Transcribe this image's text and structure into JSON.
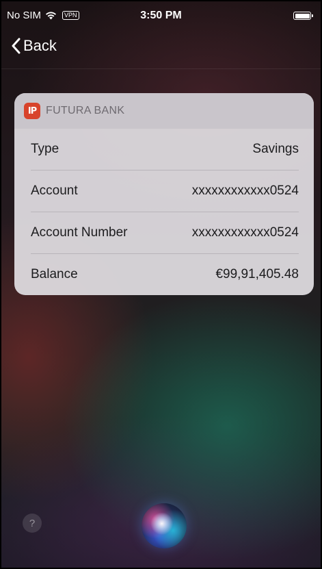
{
  "status_bar": {
    "carrier": "No SIM",
    "vpn": "VPN",
    "time": "3:50 PM"
  },
  "nav": {
    "back_label": "Back"
  },
  "card": {
    "bank_logo": "IP",
    "bank_name": "FUTURA BANK",
    "rows": [
      {
        "label": "Type",
        "value": "Savings"
      },
      {
        "label": "Account",
        "value": "xxxxxxxxxxxx0524"
      },
      {
        "label": "Account Number",
        "value": "xxxxxxxxxxxx0524"
      },
      {
        "label": "Balance",
        "value": "€99,91,405.48"
      }
    ]
  },
  "bottom": {
    "help_label": "?"
  },
  "colors": {
    "bank_accent": "#d8432b"
  },
  "icons": {
    "wifi": "wifi-icon",
    "battery": "battery-icon",
    "back": "chevron-left-icon",
    "help": "help-icon",
    "siri": "siri-orb-icon"
  }
}
